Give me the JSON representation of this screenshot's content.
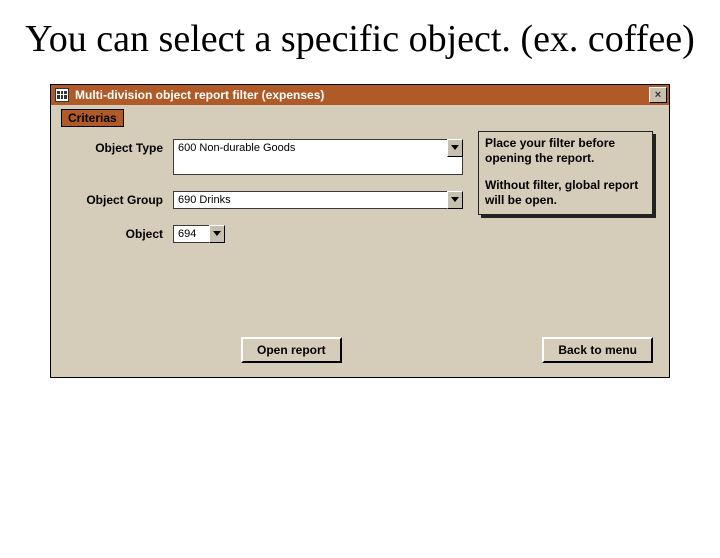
{
  "slide": {
    "title": "You can select a specific object. (ex. coffee)"
  },
  "window": {
    "title": "Multi-division object report filter (expenses)",
    "close_symbol": "×",
    "section_label": "Criterias",
    "labels": {
      "object_type": "Object Type",
      "object_group": "Object Group",
      "object": "Object"
    },
    "values": {
      "object_type": "600 Non-durable Goods",
      "object_group": "690 Drinks",
      "object": "694"
    },
    "info": {
      "line1": "Place your filter before opening the report.",
      "line2": "Without filter, global report will be open."
    },
    "buttons": {
      "open_report": "Open report",
      "back": "Back to menu"
    }
  }
}
